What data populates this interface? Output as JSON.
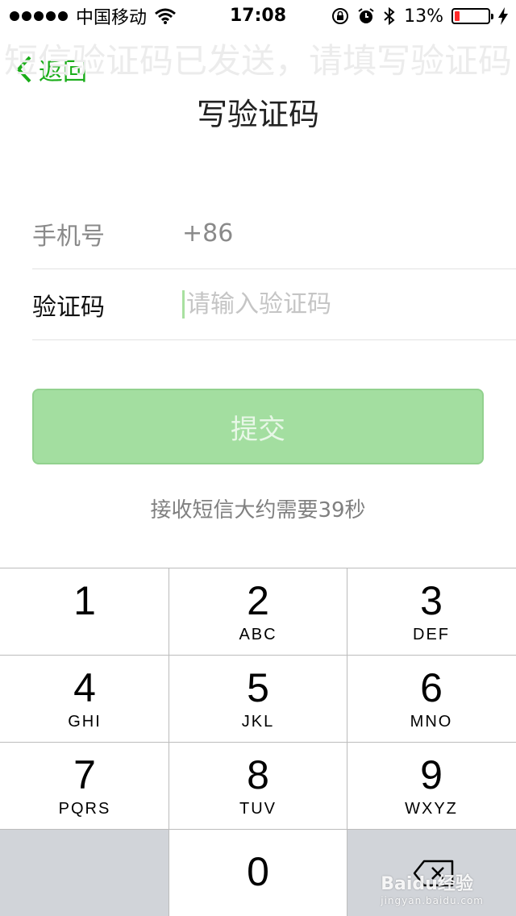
{
  "status_bar": {
    "carrier": "中国移动",
    "time": "17:08",
    "battery_percent": "13%",
    "battery_level": 0.13,
    "icons": [
      "signal-dots-icon",
      "wifi-icon",
      "rotation-lock-icon",
      "alarm-icon",
      "bluetooth-icon",
      "battery-icon",
      "charging-bolt-icon"
    ]
  },
  "nav": {
    "back_label": "返回",
    "ghost_title": "短信验证码已发送，请填写验证码",
    "title": "写验证码"
  },
  "form": {
    "phone_label": "手机号",
    "phone_value": "+86",
    "code_label": "验证码",
    "code_placeholder": "请输入验证码",
    "code_value": ""
  },
  "submit_label": "提交",
  "hint": "接收短信大约需要39秒",
  "keypad": [
    {
      "digit": "1",
      "letters": ""
    },
    {
      "digit": "2",
      "letters": "ABC"
    },
    {
      "digit": "3",
      "letters": "DEF"
    },
    {
      "digit": "4",
      "letters": "GHI"
    },
    {
      "digit": "5",
      "letters": "JKL"
    },
    {
      "digit": "6",
      "letters": "MNO"
    },
    {
      "digit": "7",
      "letters": "PQRS"
    },
    {
      "digit": "8",
      "letters": "TUV"
    },
    {
      "digit": "9",
      "letters": "WXYZ"
    },
    {
      "digit": "0",
      "letters": ""
    }
  ],
  "watermark": {
    "main": "Baidu经验",
    "sub": "jingyan.baidu.com"
  },
  "colors": {
    "accent": "#1aad19",
    "button_disabled": "#a3dea0",
    "keypad_gray": "#d1d4d9"
  }
}
